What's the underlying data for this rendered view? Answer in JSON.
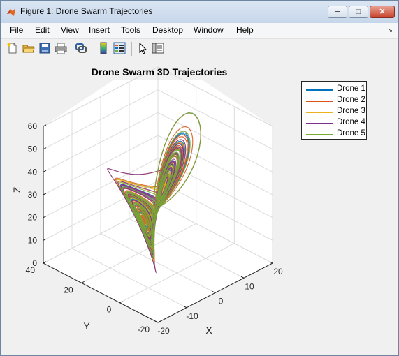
{
  "window": {
    "title": "Figure 1: Drone Swarm Trajectories"
  },
  "menu": [
    "File",
    "Edit",
    "View",
    "Insert",
    "Tools",
    "Desktop",
    "Window",
    "Help"
  ],
  "toolbar": [
    "new-figure-icon",
    "open-file-icon",
    "save-icon",
    "print-icon",
    "link-plot-icon",
    "colorbar-icon",
    "legend-icon",
    "pointer-icon",
    "property-editor-icon"
  ],
  "chart_data": {
    "type": "line",
    "title": "Drone Swarm 3D Trajectories",
    "xlabel": "X",
    "ylabel": "Y",
    "zlabel": "Z",
    "xlim": [
      -20,
      20
    ],
    "ylim": [
      -20,
      40
    ],
    "zlim": [
      0,
      60
    ],
    "xticks": [
      "-20",
      "-10",
      "0",
      "10",
      "20"
    ],
    "yticks": [
      "-20",
      "0",
      "20",
      "40"
    ],
    "zticks": [
      "0",
      "10",
      "20",
      "30",
      "40",
      "50",
      "60"
    ],
    "grid": true,
    "legend_position": "top-right",
    "series": [
      {
        "name": "Drone 1",
        "color": "#0072BD"
      },
      {
        "name": "Drone 2",
        "color": "#D95319"
      },
      {
        "name": "Drone 3",
        "color": "#EDB120"
      },
      {
        "name": "Drone 4",
        "color": "#7E2F8E"
      },
      {
        "name": "Drone 5",
        "color": "#77AC30"
      }
    ]
  }
}
